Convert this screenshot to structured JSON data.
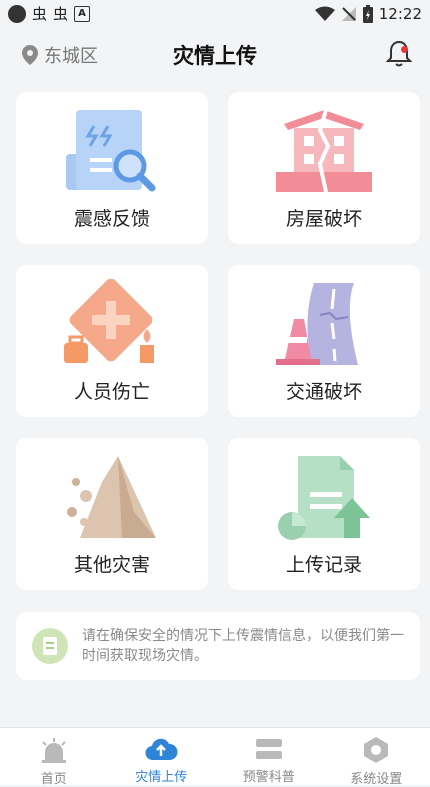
{
  "status_bar": {
    "time": "12:22",
    "a_icon": "A"
  },
  "header": {
    "location": "东城区",
    "title": "灾情上传"
  },
  "cards": [
    {
      "label": "震感反馈",
      "icon": "seismic-report-icon"
    },
    {
      "label": "房屋破坏",
      "icon": "house-damage-icon"
    },
    {
      "label": "人员伤亡",
      "icon": "casualty-icon"
    },
    {
      "label": "交通破坏",
      "icon": "traffic-damage-icon"
    },
    {
      "label": "其他灾害",
      "icon": "other-disaster-icon"
    },
    {
      "label": "上传记录",
      "icon": "upload-record-icon"
    }
  ],
  "notice": {
    "text": "请在确保安全的情况下上传震情信息，以便我们第一时间获取现场灾情。"
  },
  "tabs": [
    {
      "label": "首页",
      "icon": "home-alarm-icon",
      "active": false
    },
    {
      "label": "灾情上传",
      "icon": "cloud-upload-icon",
      "active": true
    },
    {
      "label": "预警科普",
      "icon": "layers-icon",
      "active": false
    },
    {
      "label": "系统设置",
      "icon": "hexagon-settings-icon",
      "active": false
    }
  ],
  "colors": {
    "accent": "#2f84d8",
    "alert_dot": "#e53935"
  }
}
